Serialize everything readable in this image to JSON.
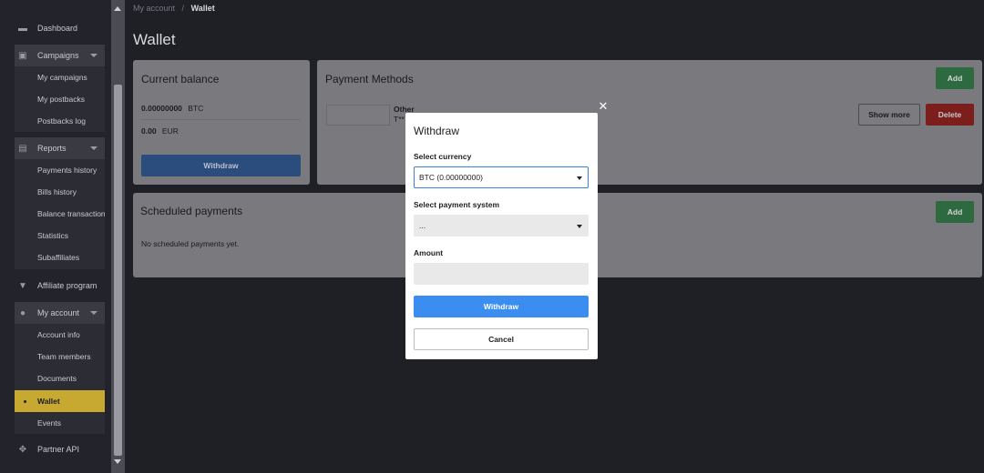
{
  "sidebar": {
    "dashboard": "Dashboard",
    "campaigns": {
      "label": "Campaigns",
      "items": [
        "My campaigns",
        "My postbacks",
        "Postbacks log"
      ]
    },
    "reports": {
      "label": "Reports",
      "items": [
        "Payments history",
        "Bills history",
        "Balance transactions",
        "Statistics",
        "Subaffiliates"
      ]
    },
    "affiliate_program": "Affiliate program",
    "my_account": {
      "label": "My account",
      "items": [
        "Account info",
        "Team members",
        "Documents",
        "Wallet",
        "Events"
      ]
    },
    "partner_api": "Partner API"
  },
  "breadcrumb": {
    "parent": "My account",
    "separator": "/",
    "current": "Wallet"
  },
  "page_title": "Wallet",
  "current_balance": {
    "title": "Current balance",
    "rows": [
      {
        "amount": "0.00000000",
        "currency": "BTC"
      },
      {
        "amount": "0.00",
        "currency": "EUR"
      }
    ],
    "withdraw_label": "Withdraw"
  },
  "payment_methods": {
    "title": "Payment Methods",
    "add_label": "Add",
    "method_name": "Other",
    "method_masked": "T**",
    "show_more_label": "Show more",
    "delete_label": "Delete"
  },
  "scheduled_payments": {
    "title": "Scheduled payments",
    "add_label": "Add",
    "empty_text": "No scheduled payments yet."
  },
  "modal": {
    "title": "Withdraw",
    "close_glyph": "✕",
    "currency_label": "Select currency",
    "currency_value": "BTC (0.00000000)",
    "payment_system_label": "Select payment system",
    "payment_system_value": "...",
    "amount_label": "Amount",
    "amount_value": "",
    "withdraw_label": "Withdraw",
    "cancel_label": "Cancel"
  },
  "colors": {
    "accent_blue": "#3b8ef0",
    "active_yellow": "#c7a830",
    "add_green": "#2e6a3f",
    "delete_red": "#7c1f1c"
  }
}
